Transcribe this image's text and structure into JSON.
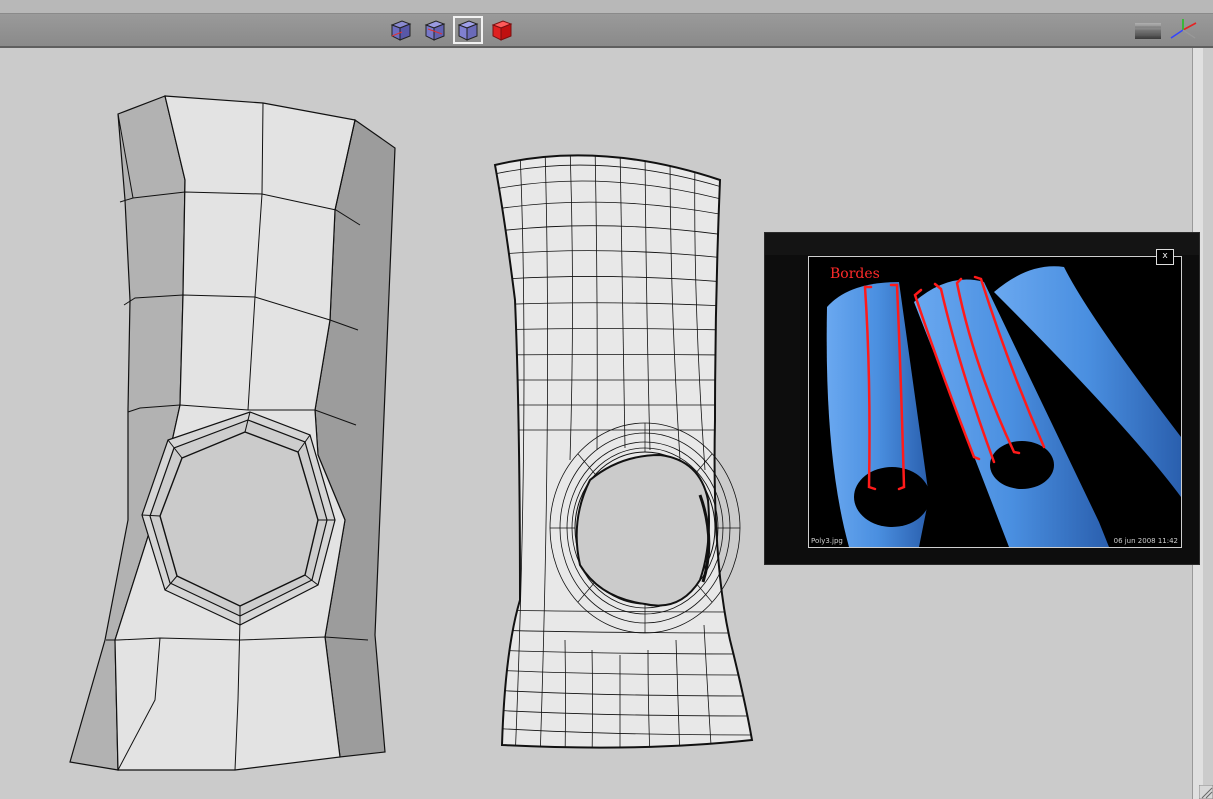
{
  "toolbar": {
    "view_modes": [
      {
        "icon": "wireframe-cube-icon"
      },
      {
        "icon": "shaded-wireframe-cube-icon"
      },
      {
        "icon": "smooth-shaded-cube-icon"
      },
      {
        "icon": "textured-cube-icon"
      }
    ],
    "active_view_mode_index": 2,
    "right_icons": [
      "gradient-background-icon",
      "axis-gizmo-icon"
    ]
  },
  "reference_image": {
    "annotation": "Bordes",
    "file_name": "Poly3.jpg",
    "timestamp": "06 jun 2008 11:42",
    "close_label": "x"
  },
  "colors": {
    "toolbar_bg": "#8e8e8e",
    "viewport_bg": "#cbcbcb",
    "mesh_face": "#e2e2e2",
    "annotation_red": "#ff1a1a",
    "tube_blue": "#4a8fe0"
  }
}
